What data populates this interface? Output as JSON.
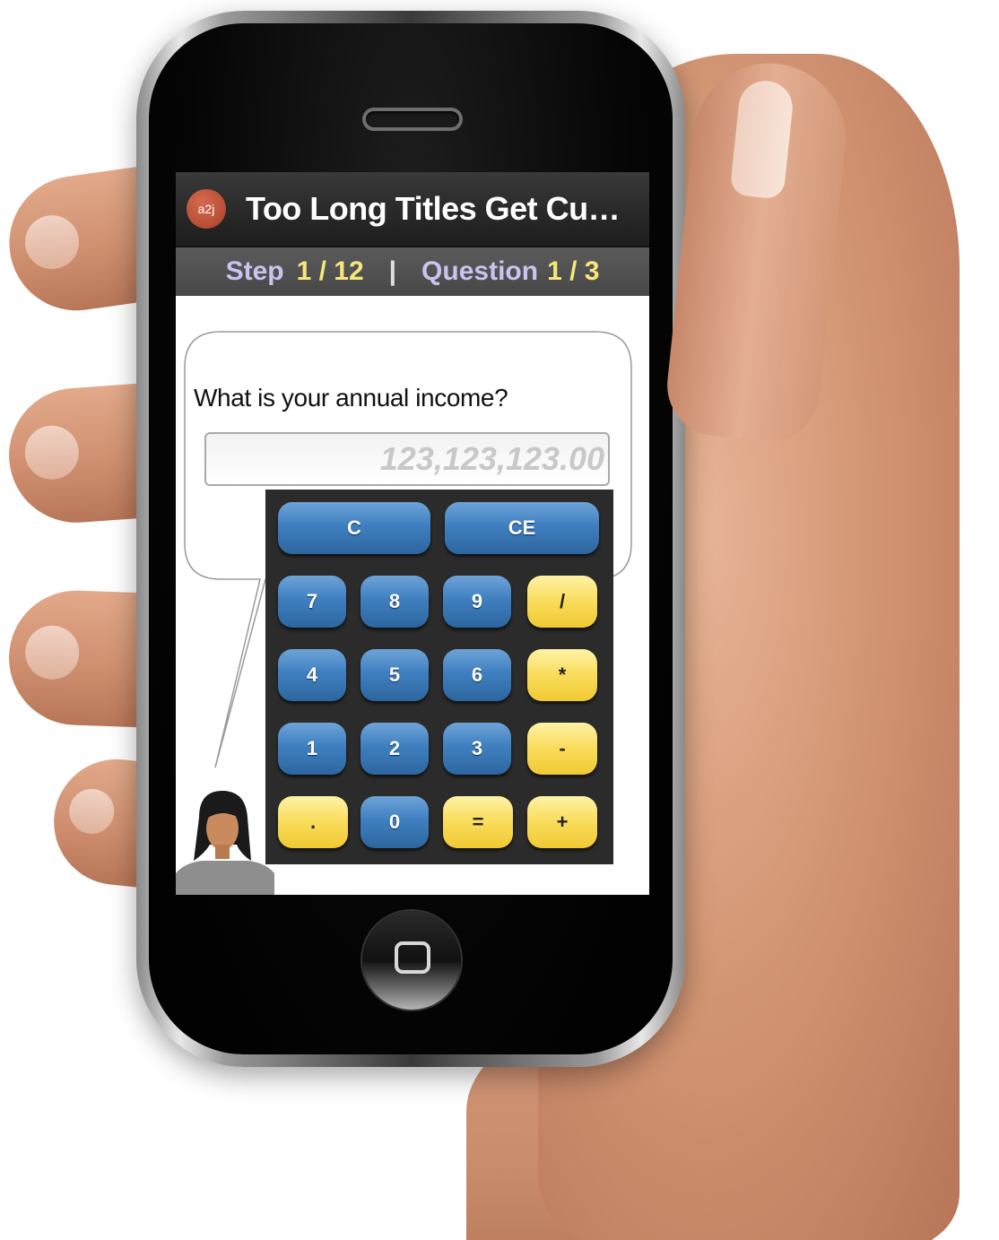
{
  "app": {
    "logo_text": "a2j",
    "title": "Too Long Titles Get Cu…"
  },
  "progress": {
    "step_label": "Step",
    "step_value": "1 / 12",
    "separator": "|",
    "question_label": "Question",
    "question_value": "1 / 3"
  },
  "question": {
    "text": "What is your annual income?",
    "answer_placeholder": "123,123,123.00"
  },
  "calculator": {
    "keys": [
      "C",
      "CE",
      "7",
      "8",
      "9",
      "/",
      "4",
      "5",
      "6",
      "*",
      "1",
      "2",
      "3",
      "-",
      ".",
      "0",
      "=",
      "+"
    ]
  },
  "colors": {
    "title_bar": "#2a2a2a",
    "step_label": "#c9c3ef",
    "step_value": "#f5e77a",
    "key_blue": "#3f7fc0",
    "key_yellow": "#f9dc5a",
    "calc_panel": "#2b2b2b"
  },
  "icons": {
    "logo": "a2j-logo-icon",
    "avatar": "guide-avatar-icon",
    "home": "home-button-icon"
  }
}
